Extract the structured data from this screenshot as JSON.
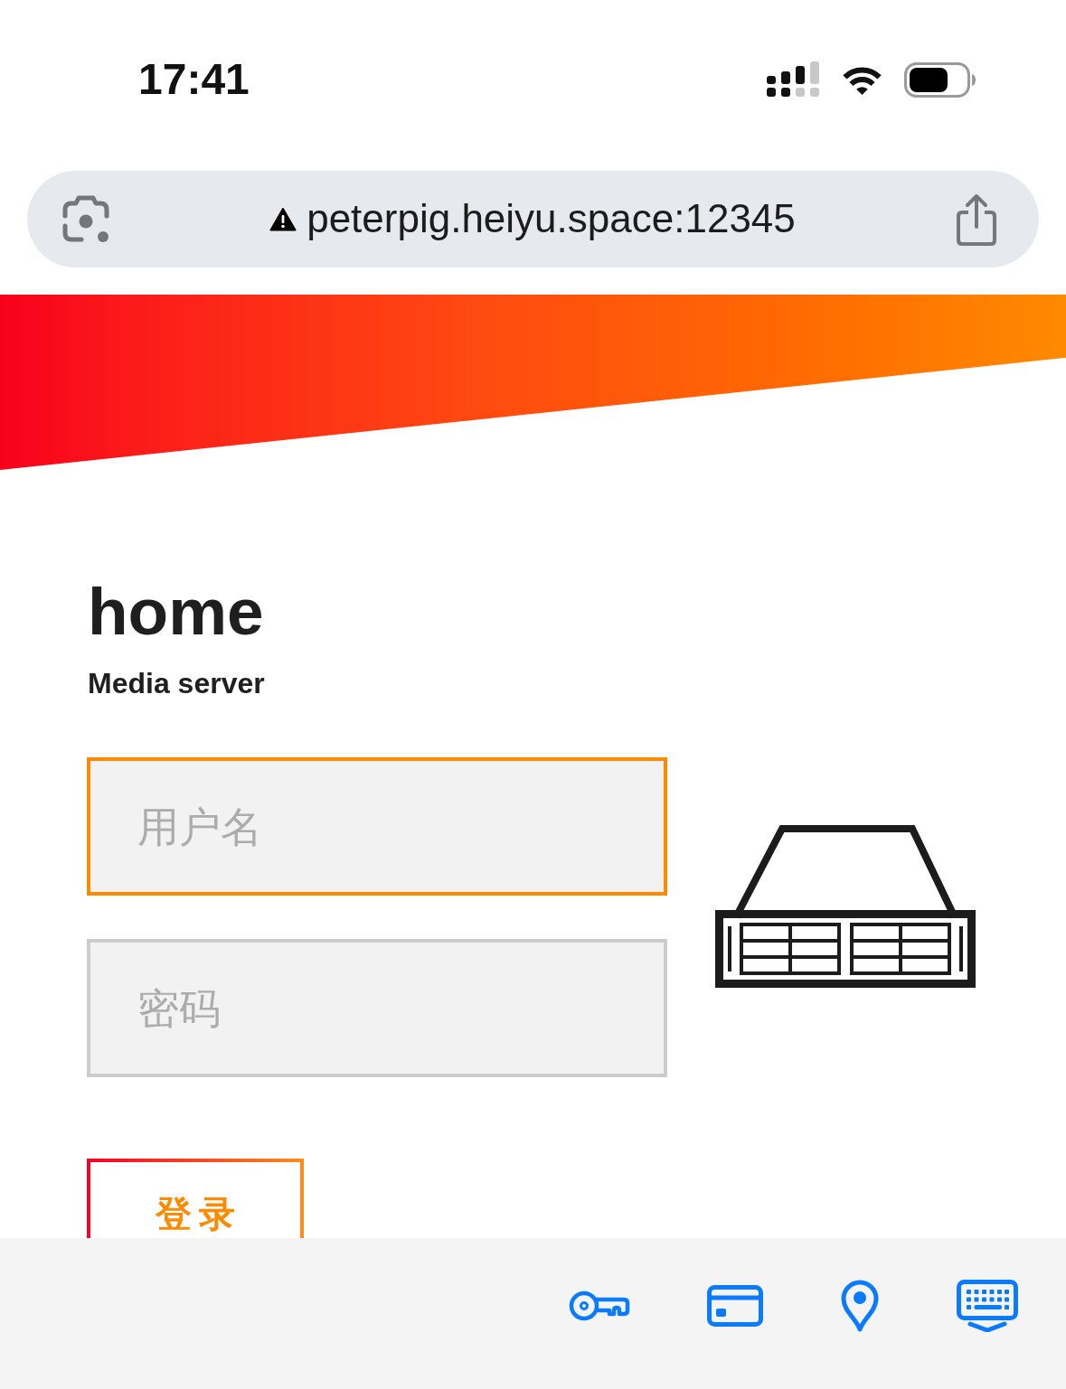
{
  "status_bar": {
    "time": "17:41"
  },
  "address_bar": {
    "insecure": true,
    "url": "peterpig.heiyu.space:12345"
  },
  "header": {
    "title": "home",
    "subtitle": "Media server"
  },
  "login_form": {
    "fields": [
      {
        "placeholder": "用户名",
        "focused": true
      },
      {
        "placeholder": "密码",
        "focused": false
      }
    ],
    "submit": "登录"
  }
}
